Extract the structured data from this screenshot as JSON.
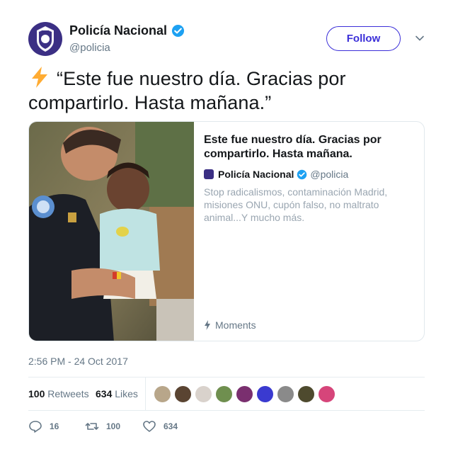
{
  "header": {
    "name": "Policía Nacional",
    "handle": "@policia",
    "follow_label": "Follow"
  },
  "tweet": {
    "text": "“Este fue nuestro día. Gracias por compartirlo. Hasta mañana.”",
    "emoji_icon": "lightning-bolt-icon",
    "timestamp": "2:56 PM - 24 Oct 2017"
  },
  "card": {
    "title": "Este fue nuestro día. Gracias por compartirlo. Hasta mañana.",
    "author_name": "Policía Nacional",
    "author_handle": "@policia",
    "description": "Stop radicalismos, contaminación Madrid, misiones ONU, cupón falso, no maltrato animal...Y mucho más.",
    "moments_label": "Moments"
  },
  "stats": {
    "retweets_count": "100",
    "retweets_label": "Retweets",
    "likes_count": "634",
    "likes_label": "Likes"
  },
  "actions": {
    "reply_count": "16",
    "retweet_count": "100",
    "like_count": "634"
  },
  "colors": {
    "accent": "#3b2fd8",
    "verified": "#1da1f2",
    "muted": "#657786",
    "border": "#e1e8ed"
  }
}
